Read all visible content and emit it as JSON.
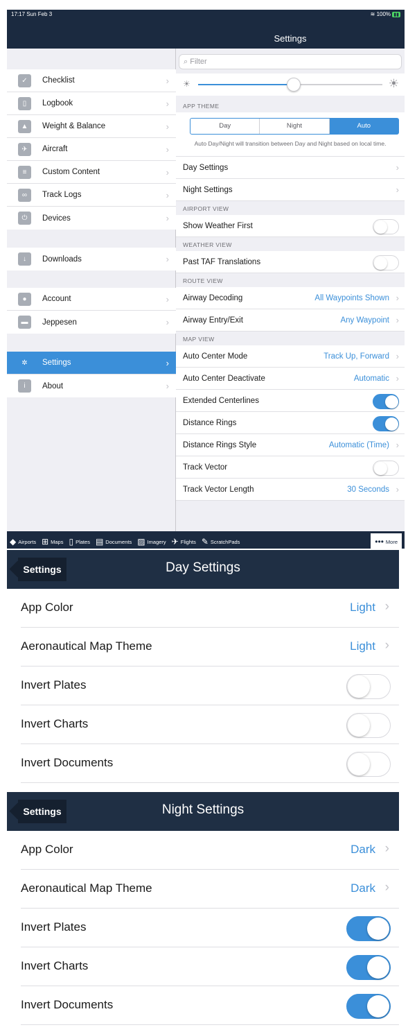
{
  "status": {
    "time": "17:17  Sun Feb 3",
    "battery": "100%"
  },
  "ipad": {
    "nav_title": "Settings",
    "sidebar": [
      {
        "label": "Checklist",
        "icon": "checkmark-icon"
      },
      {
        "label": "Logbook",
        "icon": "book-icon"
      },
      {
        "label": "Weight & Balance",
        "icon": "scale-weight-icon"
      },
      {
        "label": "Aircraft",
        "icon": "airplane-icon"
      },
      {
        "label": "Custom Content",
        "icon": "document-icon"
      },
      {
        "label": "Track Logs",
        "icon": "tracklog-icon"
      },
      {
        "label": "Devices",
        "icon": "plug-icon"
      },
      {
        "label": "Downloads",
        "icon": "download-icon"
      },
      {
        "label": "Account",
        "icon": "person-icon"
      },
      {
        "label": "Jeppesen",
        "icon": "jeppesen-icon"
      },
      {
        "label": "Settings",
        "icon": "gear-icon",
        "active": true
      },
      {
        "label": "About",
        "icon": "info-icon"
      }
    ],
    "filter_placeholder": "Filter",
    "brightness": 0.52,
    "app_theme_header": "APP THEME",
    "theme_options": [
      "Day",
      "Night",
      "Auto"
    ],
    "theme_selected": "Auto",
    "theme_note": "Auto Day/Night will transition between Day and Night based on local time.",
    "day_settings": "Day Settings",
    "night_settings": "Night Settings",
    "airport_view_header": "AIRPORT VIEW",
    "show_weather_first": "Show Weather First",
    "weather_view_header": "WEATHER VIEW",
    "past_taf": "Past TAF Translations",
    "route_view_header": "ROUTE VIEW",
    "airway_decoding": {
      "label": "Airway Decoding",
      "value": "All Waypoints Shown"
    },
    "airway_entry": {
      "label": "Airway Entry/Exit",
      "value": "Any Waypoint"
    },
    "map_view_header": "MAP VIEW",
    "auto_center_mode": {
      "label": "Auto Center Mode",
      "value": "Track Up, Forward"
    },
    "auto_center_deactivate": {
      "label": "Auto Center Deactivate",
      "value": "Automatic"
    },
    "extended_centerlines": {
      "label": "Extended Centerlines",
      "on": true
    },
    "distance_rings": {
      "label": "Distance Rings",
      "on": true
    },
    "distance_rings_style": {
      "label": "Distance Rings Style",
      "value": "Automatic (Time)"
    },
    "track_vector": {
      "label": "Track Vector",
      "on": false
    },
    "track_vector_length": {
      "label": "Track Vector Length",
      "value": "30 Seconds"
    },
    "tabs": [
      "Airports",
      "Maps",
      "Plates",
      "Documents",
      "Imagery",
      "Flights",
      "ScratchPads",
      "More"
    ]
  },
  "day": {
    "back": "Settings",
    "title": "Day Settings",
    "app_color": {
      "label": "App Color",
      "value": "Light"
    },
    "map_theme": {
      "label": "Aeronautical Map Theme",
      "value": "Light"
    },
    "invert_plates": {
      "label": "Invert Plates",
      "on": false
    },
    "invert_charts": {
      "label": "Invert Charts",
      "on": false
    },
    "invert_documents": {
      "label": "Invert Documents",
      "on": false
    }
  },
  "night": {
    "back": "Settings",
    "title": "Night Settings",
    "app_color": {
      "label": "App Color",
      "value": "Dark"
    },
    "map_theme": {
      "label": "Aeronautical Map Theme",
      "value": "Dark"
    },
    "invert_plates": {
      "label": "Invert Plates",
      "on": true
    },
    "invert_charts": {
      "label": "Invert Charts",
      "on": true
    },
    "invert_documents": {
      "label": "Invert Documents",
      "on": true
    }
  },
  "colors": {
    "accent": "#3b8fd9",
    "navbar": "#1b2a40"
  }
}
